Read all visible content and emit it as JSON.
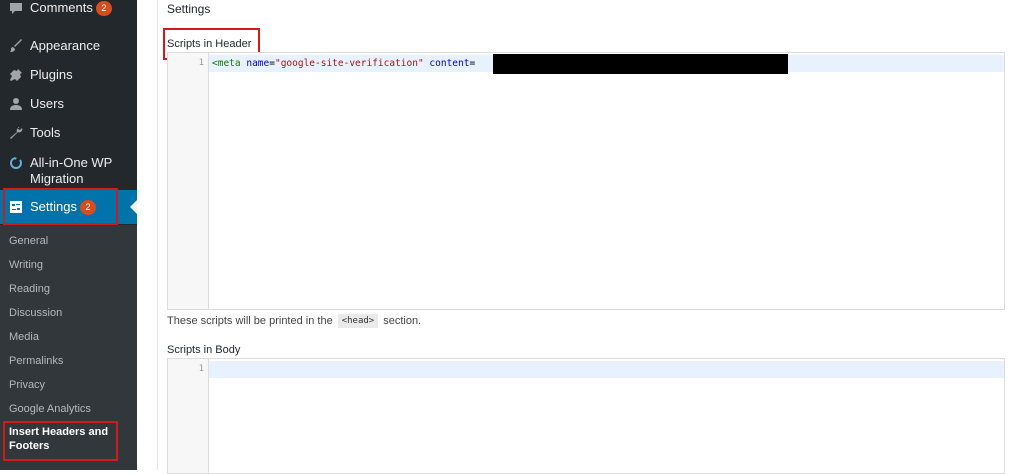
{
  "sidebar": {
    "comments": {
      "label": "Comments",
      "badge": "2",
      "icon": "comment-icon"
    },
    "appearance": {
      "label": "Appearance",
      "icon": "paintbrush-icon"
    },
    "plugins": {
      "label": "Plugins",
      "icon": "plugin-icon"
    },
    "users": {
      "label": "Users",
      "icon": "user-icon"
    },
    "tools": {
      "label": "Tools",
      "icon": "wrench-icon"
    },
    "migration": {
      "label_line1": "All-in-One WP",
      "label_line2": "Migration",
      "icon": "migration-icon"
    },
    "settings": {
      "label": "Settings",
      "badge": "2",
      "icon": "settings-icon"
    },
    "submenu": [
      "General",
      "Writing",
      "Reading",
      "Discussion",
      "Media",
      "Permalinks",
      "Privacy",
      "Google Analytics"
    ],
    "current_submenu": {
      "line1": "Insert Headers and",
      "line2": "Footers"
    }
  },
  "main": {
    "title": "Settings",
    "header_section": {
      "label": "Scripts in Header",
      "line_number": "1",
      "code_tag": "<meta",
      "code_attr1": "name",
      "code_eq1": "=",
      "code_val1": "\"google-site-verification\"",
      "code_attr2": "content",
      "code_eq2": "="
    },
    "help": {
      "before": "These scripts will be printed in the",
      "code": "<head>",
      "after": "section."
    },
    "body_section": {
      "label": "Scripts in Body",
      "line_number": "1"
    }
  },
  "colors": {
    "sidebar_bg": "#23282d",
    "submenu_bg": "#32373c",
    "active_bg": "#0073aa",
    "badge": "#d54e21",
    "highlight_box": "#d11a1a"
  }
}
